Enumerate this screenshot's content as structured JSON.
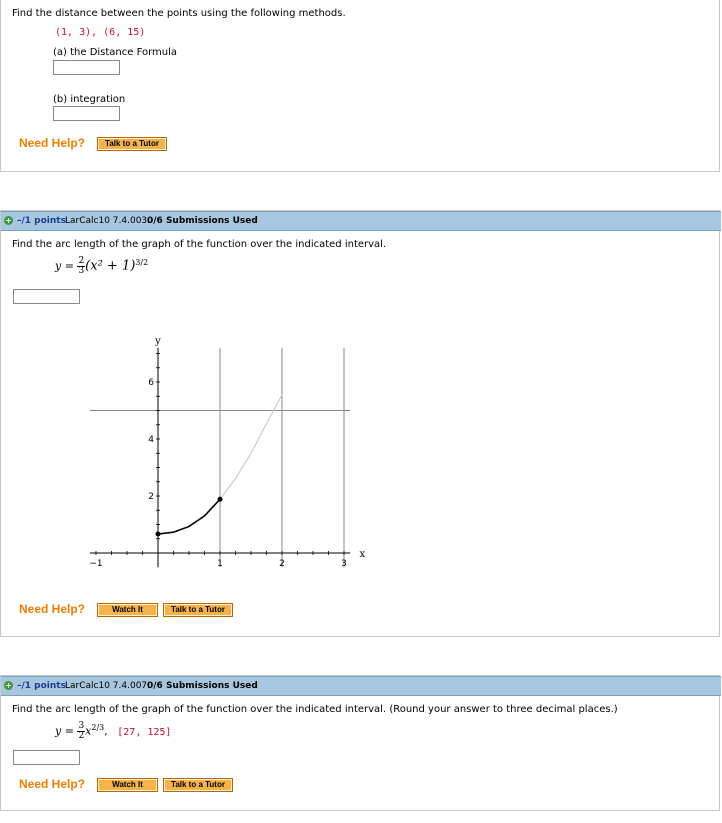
{
  "q1": {
    "prompt": "Find the distance between the points using the following methods.",
    "points": "(1, 3), (6, 15)",
    "part_a": "(a) the Distance Formula",
    "part_b": "(b) integration",
    "need_help": "Need Help?",
    "talk_tutor": "Talk to a Tutor"
  },
  "q2": {
    "points_label": "–/1 points",
    "ref": "LarCalc10 7.4.003.",
    "submissions": "0/6 Submissions Used",
    "prompt": "Find the arc length of the graph of the function over the indicated interval.",
    "eq_lhs": "y =",
    "frac_num": "2",
    "frac_den": "3",
    "eq_body": "(x² + 1)",
    "eq_exp": "3/2",
    "need_help": "Need Help?",
    "watch_it": "Watch It",
    "talk_tutor": "Talk to a Tutor"
  },
  "q3": {
    "points_label": "–/1 points",
    "ref": "LarCalc10 7.4.007.",
    "submissions": "0/6 Submissions Used",
    "prompt": "Find the arc length of the graph of the function over the indicated interval. (Round your answer to three decimal places.)",
    "eq_lhs": "y =",
    "frac_num": "3",
    "frac_den": "2",
    "eq_body": "x",
    "eq_exp": "2/3",
    "interval": "[27, 125]",
    "need_help": "Need Help?",
    "watch_it": "Watch It",
    "talk_tutor": "Talk to a Tutor"
  },
  "chart_data": {
    "type": "line",
    "xlabel": "x",
    "ylabel": "y",
    "xlim": [
      -1,
      3
    ],
    "ylim": [
      0,
      7
    ],
    "x_ticks": [
      -1,
      1,
      2,
      3
    ],
    "y_ticks": [
      2,
      4,
      6
    ],
    "series": [
      {
        "x": [
          0,
          0.25,
          0.5,
          0.75,
          1
        ],
        "y": [
          0.667,
          0.729,
          0.932,
          1.302,
          1.886
        ],
        "highlighted": true
      },
      {
        "x": [
          1,
          1.25,
          1.5,
          1.75,
          2
        ],
        "y": [
          1.886,
          2.617,
          3.5,
          4.539,
          5.55
        ],
        "highlighted": false
      }
    ],
    "endpoints": [
      [
        0,
        0.667
      ],
      [
        1,
        1.886
      ]
    ],
    "vertical_lines_x": [
      1,
      2,
      3
    ],
    "horizontal_line_y": 5
  }
}
